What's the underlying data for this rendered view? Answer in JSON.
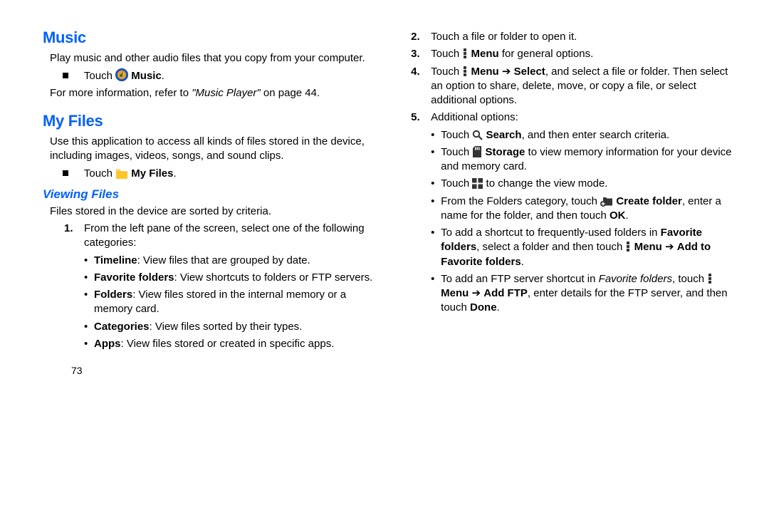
{
  "left": {
    "h_music": "Music",
    "music_intro": "Play music and other audio files that you copy from your computer.",
    "touch": "Touch ",
    "music_bold": "Music",
    "music_ref_1": "For more information, refer to ",
    "music_ref_italic": "\"Music Player\"",
    "music_ref_2": " on page 44.",
    "h_myfiles": "My Files",
    "myfiles_intro": "Use this application to access all kinds of files stored in the device, including images, videos, songs, and sound clips.",
    "myfiles_bold": "My Files",
    "h_viewing": "Viewing Files",
    "viewing_intro": "Files stored in the device are sorted by criteria.",
    "step1_num": "1.",
    "step1": "From the left pane of the screen, select one of the following categories:",
    "cat1_b": "Timeline",
    "cat1_r": ": View files that are grouped by date.",
    "cat2_b": "Favorite folders",
    "cat2_r": ": View shortcuts to folders or FTP servers.",
    "cat3_b": "Folders",
    "cat3_r": ": View files stored in the internal memory or a memory card.",
    "cat4_b": "Categories",
    "cat4_r": ": View files sorted by their types.",
    "cat5_b": "Apps",
    "cat5_r": ": View files stored or created in specific apps.",
    "page_num": "73"
  },
  "right": {
    "step2_num": "2.",
    "step2": "Touch a file or folder to open it.",
    "step3_num": "3.",
    "step3_a": "Touch ",
    "step3_menu": "Menu",
    "step3_b": " for general options.",
    "step4_num": "4.",
    "step4_a": "Touch ",
    "step4_menu": "Menu",
    "step4_arrow": " ➔ ",
    "step4_select": "Select",
    "step4_b": ", and select a file or folder. Then select an option to share, delete, move, or copy a file, or select additional options.",
    "step5_num": "5.",
    "step5": "Additional options:",
    "b1_a": "Touch ",
    "b1_search": "Search",
    "b1_b": ", and then enter search criteria.",
    "b2_a": "Touch ",
    "b2_storage": "Storage",
    "b2_b": " to view memory information for your device and memory card.",
    "b3_a": "Touch ",
    "b3_b": " to change the view mode.",
    "b4_a": "From the Folders category, touch ",
    "b4_create": "Create folder",
    "b4_b": ", enter a name for the folder, and then touch ",
    "b4_ok": "OK",
    "b4_c": ".",
    "b5_a": "To add a shortcut to frequently-used folders in ",
    "b5_fav": "Favorite folders",
    "b5_b": ", select a folder and then touch ",
    "b5_menu": "Menu",
    "b5_arrow": " ➔ ",
    "b5_add": "Add to Favorite folders",
    "b5_c": ".",
    "b6_a": "To add an FTP server shortcut in ",
    "b6_favit": "Favorite folders",
    "b6_b": ", touch ",
    "b6_menu": "Menu",
    "b6_arrow": " ➔ ",
    "b6_ftp": "Add FTP",
    "b6_c": ", enter details for the FTP server, and then touch ",
    "b6_done": "Done",
    "b6_d": "."
  }
}
